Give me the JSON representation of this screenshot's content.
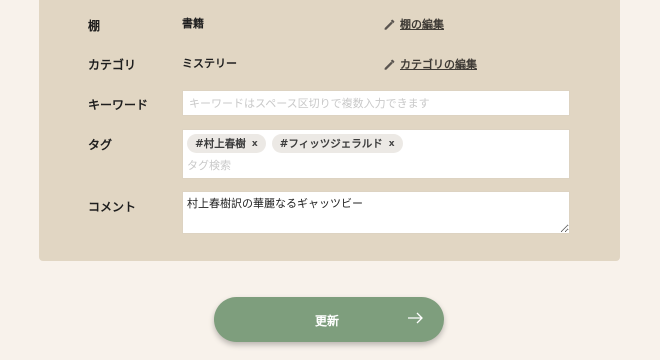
{
  "form": {
    "shelf": {
      "label": "棚",
      "value": "書籍",
      "edit_label": "棚の編集"
    },
    "category": {
      "label": "カテゴリ",
      "value": "ミステリー",
      "edit_label": "カテゴリの編集"
    },
    "keyword": {
      "label": "キーワード",
      "placeholder": "キーワードはスペース区切りで複数入力できます",
      "value": ""
    },
    "tags": {
      "label": "タグ",
      "items": [
        {
          "text": "#村上春樹",
          "remove": "x"
        },
        {
          "text": "#フィッツジェラルド",
          "remove": "x"
        }
      ],
      "search_placeholder": "タグ検索"
    },
    "comment": {
      "label": "コメント",
      "value": "村上春樹訳の華麗なるギャッツビー"
    }
  },
  "submit": {
    "label": "更新",
    "arrow_icon": "arrow-right-icon"
  },
  "colors": {
    "background": "#f8f2eb",
    "panel": "#e1d6c3",
    "submit_button": "#7e9e7d"
  }
}
